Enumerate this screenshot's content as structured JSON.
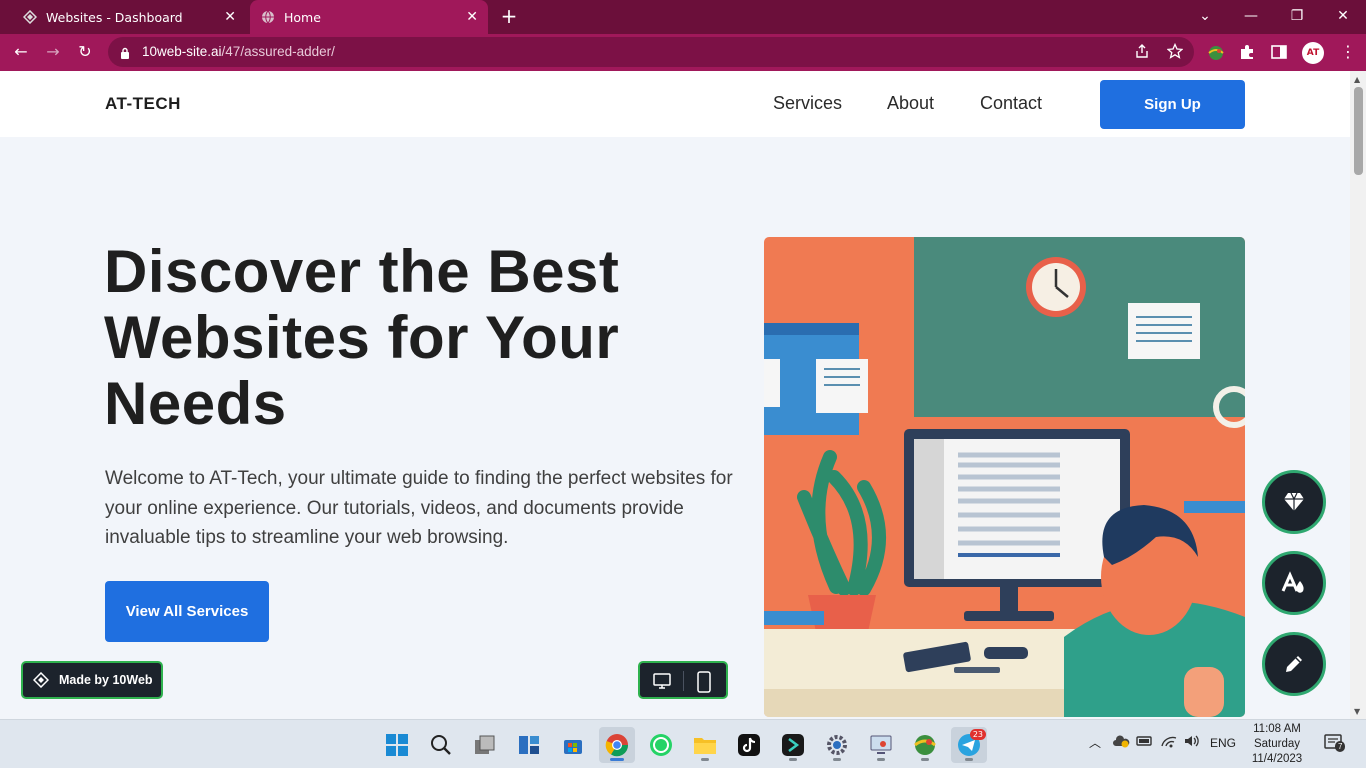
{
  "browser": {
    "tabs": [
      {
        "title": "Websites - Dashboard",
        "active": false
      },
      {
        "title": "Home",
        "active": true
      }
    ],
    "url_host": "10web-site.ai",
    "url_path": "/47/assured-adder/",
    "profile_initials": "AT",
    "colors": {
      "tabbar": "#6b0f3a",
      "toolbar": "#a0185a"
    }
  },
  "site": {
    "logo": "AT-TECH",
    "nav": [
      "Services",
      "About",
      "Contact"
    ],
    "signup": "Sign Up",
    "hero_title": "Discover the Best Websites for Your Needs",
    "hero_text": "Welcome to AT-Tech, your ultimate guide to finding the perfect websites for your online experience. Our tutorials, videos, and documents provide invaluable tips to streamline your web browsing.",
    "cta": "View All Services",
    "accent": "#1f6fe0"
  },
  "builder": {
    "made_by": "Made by 10Web",
    "fabs": [
      "diamond-icon",
      "fill-color-icon",
      "pencil-icon"
    ]
  },
  "taskbar": {
    "apps": [
      "start",
      "search",
      "task-view",
      "widgets",
      "store",
      "chrome",
      "whatsapp",
      "file-explorer",
      "tiktok",
      "capcut",
      "settings",
      "remote-desktop",
      "earth",
      "telegram"
    ],
    "telegram_badge": "23",
    "language": "ENG",
    "time": "11:08 AM",
    "day": "Saturday",
    "date": "11/4/2023",
    "notifications": "7"
  }
}
